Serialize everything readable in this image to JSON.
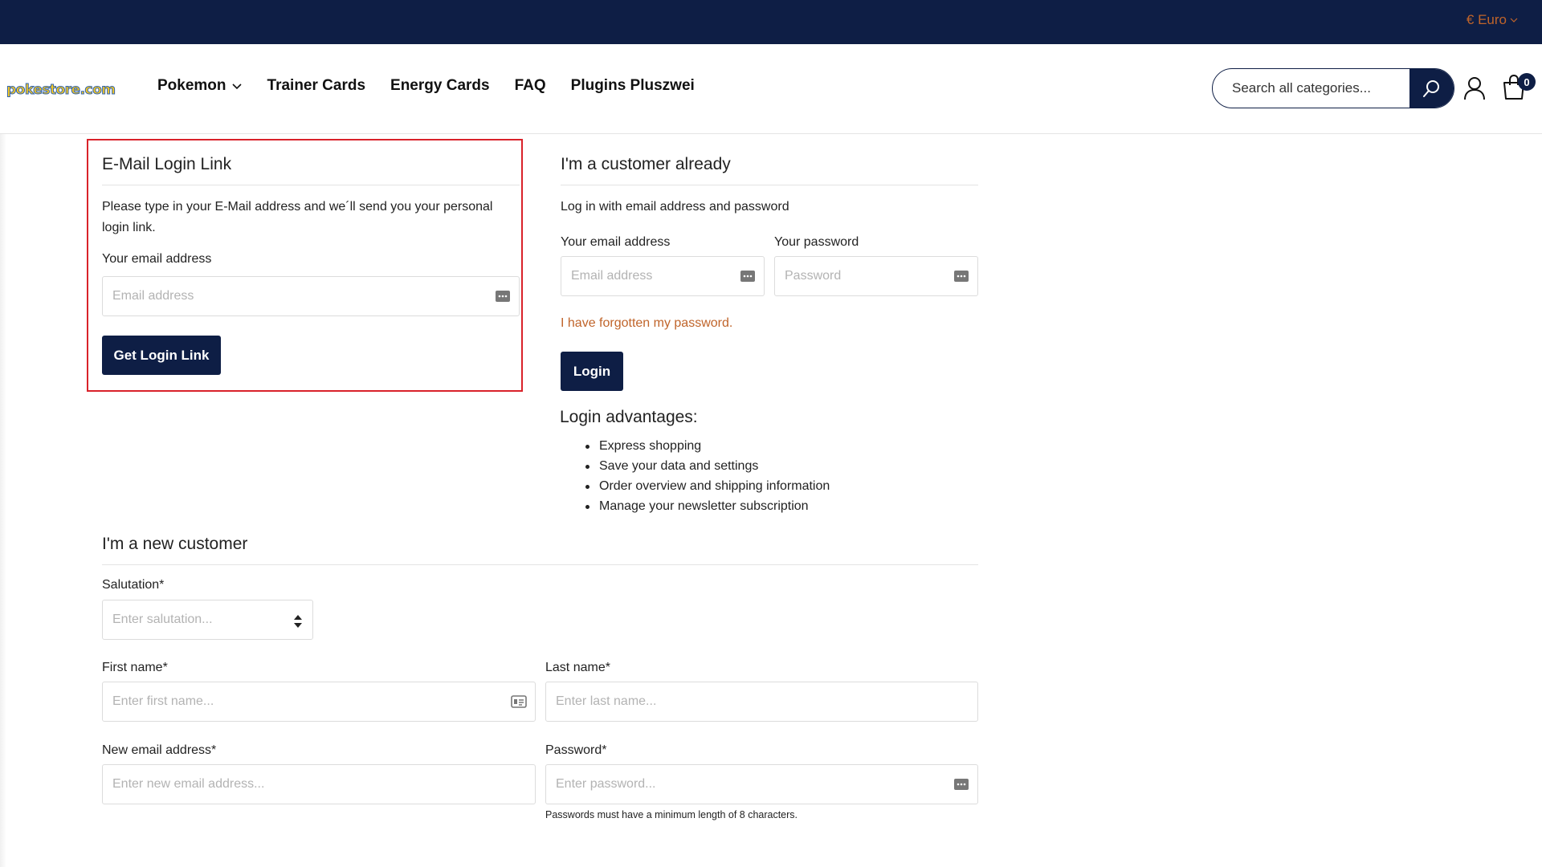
{
  "topbar": {
    "currency_label": "€ Euro"
  },
  "header": {
    "logo_text": "pokestore.com",
    "nav": [
      {
        "label": "Pokemon",
        "has_dropdown": true
      },
      {
        "label": "Trainer Cards"
      },
      {
        "label": "Energy Cards"
      },
      {
        "label": "FAQ"
      },
      {
        "label": "Plugins Pluszwei"
      }
    ],
    "search_placeholder": "Search all categories...",
    "cart_count": "0"
  },
  "email_login": {
    "title": "E-Mail Login Link",
    "description": "Please type in your E-Mail address and we´ll send you your personal login link.",
    "email_label": "Your email address",
    "email_placeholder": "Email address",
    "button_label": "Get Login Link"
  },
  "existing_customer": {
    "title": "I'm a customer already",
    "subtitle": "Log in with email address and password",
    "email_label": "Your email address",
    "email_placeholder": "Email address",
    "password_label": "Your password",
    "password_placeholder": "Password",
    "forgot_link": "I have forgotten my password.",
    "login_button": "Login",
    "advantages_title": "Login advantages:",
    "advantages": [
      "Express shopping",
      "Save your data and settings",
      "Order overview and shipping information",
      "Manage your newsletter subscription"
    ]
  },
  "new_customer": {
    "title": "I'm a new customer",
    "salutation_label": "Salutation*",
    "salutation_placeholder": "Enter salutation...",
    "first_name_label": "First name*",
    "first_name_placeholder": "Enter first name...",
    "last_name_label": "Last name*",
    "last_name_placeholder": "Enter last name...",
    "email_label": "New email address*",
    "email_placeholder": "Enter new email address...",
    "password_label": "Password*",
    "password_placeholder": "Enter password...",
    "password_hint": "Passwords must have a minimum length of 8 characters."
  },
  "colors": {
    "navy": "#0e1e45",
    "accent_orange": "#c0642a",
    "highlight_red": "#d9222a"
  }
}
